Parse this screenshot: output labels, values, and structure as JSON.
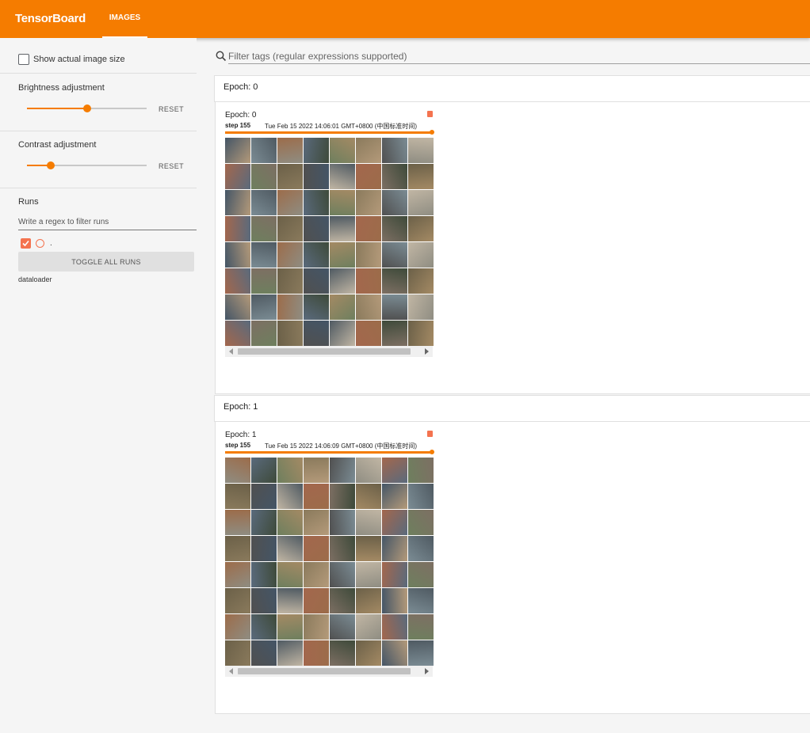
{
  "app": {
    "brand": "TensorBoard",
    "active_tab": "IMAGES"
  },
  "sidebar": {
    "show_actual_size_label": "Show actual image size",
    "show_actual_size_checked": false,
    "brightness": {
      "title": "Brightness adjustment",
      "value": 0.5,
      "reset_label": "RESET"
    },
    "contrast": {
      "title": "Contrast adjustment",
      "value": 0.2,
      "reset_label": "RESET"
    },
    "runs": {
      "title": "Runs",
      "filter_placeholder": "Write a regex to filter runs",
      "run_name": ".",
      "run_color": "#f4734f",
      "toggle_all_label": "TOGGLE ALL RUNS",
      "footer_label": "dataloader"
    }
  },
  "main": {
    "filter_placeholder": "Filter tags (regular expressions supported)",
    "groups": [
      {
        "header": "Epoch: 0",
        "card": {
          "title": "Epoch: 0",
          "step": "step 155",
          "timestamp": "Tue Feb 15 2022 14:06:01 GMT+0800 (中国标准时间)",
          "step_slider_value": 1
        }
      },
      {
        "header": "Epoch: 1",
        "card": {
          "title": "Epoch: 1",
          "step": "step 155",
          "timestamp": "Tue Feb 15 2022 14:06:09 GMT+0800 (中国标准时间)",
          "step_slider_value": 1
        }
      }
    ]
  },
  "colors": {
    "accent": "#f57c00",
    "run": "#f4734f"
  },
  "icons": [
    "search-icon",
    "check-icon"
  ]
}
